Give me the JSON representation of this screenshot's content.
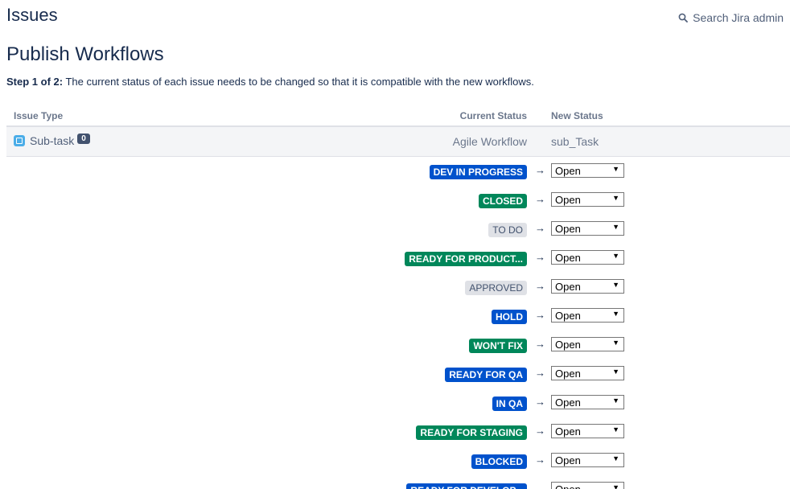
{
  "header": {
    "title": "Issues",
    "search_label": "Search Jira admin",
    "search_icon": "search-icon"
  },
  "page": {
    "title": "Publish Workflows",
    "step_label": "Step 1 of 2:",
    "step_text": " The current status of each issue needs to be changed so that it is compatible with the new workflows."
  },
  "table": {
    "headers": {
      "issue_type": "Issue Type",
      "current_status": "Current Status",
      "new_status": "New Status"
    },
    "type_row": {
      "issue_type": "Sub-task",
      "count": "0",
      "current_workflow": "Agile Workflow",
      "new_workflow": "sub_Task",
      "icon": "subtask-icon"
    },
    "mappings": [
      {
        "status": "DEV IN PROGRESS",
        "color": "blue",
        "new_status": "Open"
      },
      {
        "status": "CLOSED",
        "color": "green",
        "new_status": "Open"
      },
      {
        "status": "TO DO",
        "color": "grey",
        "new_status": "Open"
      },
      {
        "status": "READY FOR PRODUCT...",
        "color": "green",
        "new_status": "Open"
      },
      {
        "status": "APPROVED",
        "color": "grey",
        "new_status": "Open"
      },
      {
        "status": "HOLD",
        "color": "blue",
        "new_status": "Open"
      },
      {
        "status": "WON'T FIX",
        "color": "green",
        "new_status": "Open"
      },
      {
        "status": "READY FOR QA",
        "color": "blue",
        "new_status": "Open"
      },
      {
        "status": "IN QA",
        "color": "blue",
        "new_status": "Open"
      },
      {
        "status": "READY FOR STAGING",
        "color": "green",
        "new_status": "Open"
      },
      {
        "status": "BLOCKED",
        "color": "blue",
        "new_status": "Open"
      },
      {
        "status": "READY FOR DEVELOP...",
        "color": "blue",
        "new_status": "Open"
      }
    ],
    "arrow": "→",
    "caret": "▼"
  },
  "colors": {
    "blue": "#0052cc",
    "green": "#00875a",
    "grey": "#dfe1e6"
  }
}
